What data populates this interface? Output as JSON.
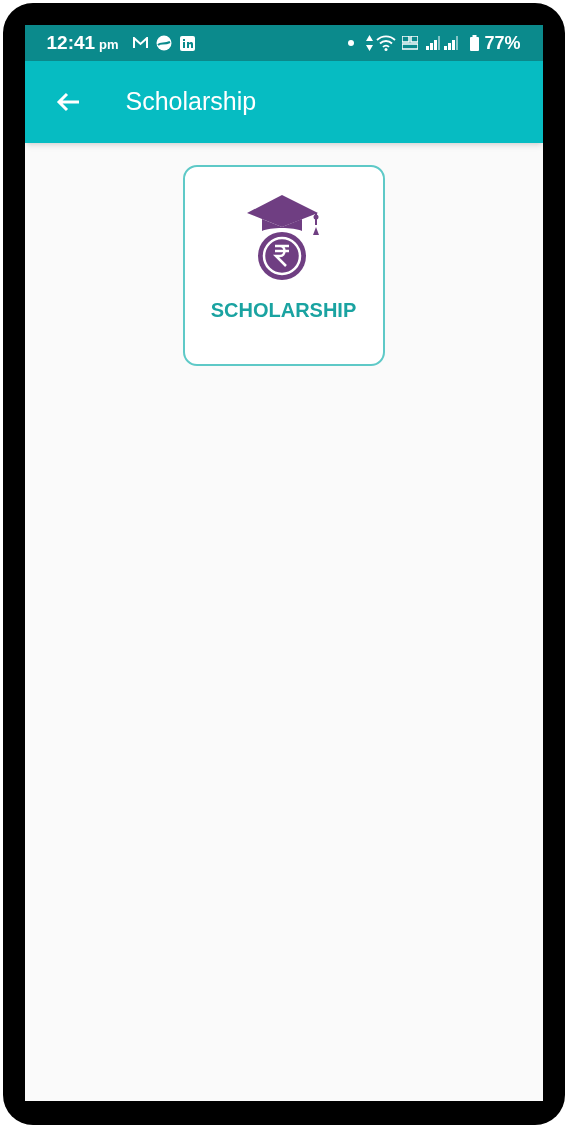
{
  "status_bar": {
    "time": "12:41",
    "period": "pm",
    "battery": "77%"
  },
  "app_bar": {
    "title": "Scholarship"
  },
  "tiles": [
    {
      "label": "SCHOLARSHIP"
    }
  ]
}
